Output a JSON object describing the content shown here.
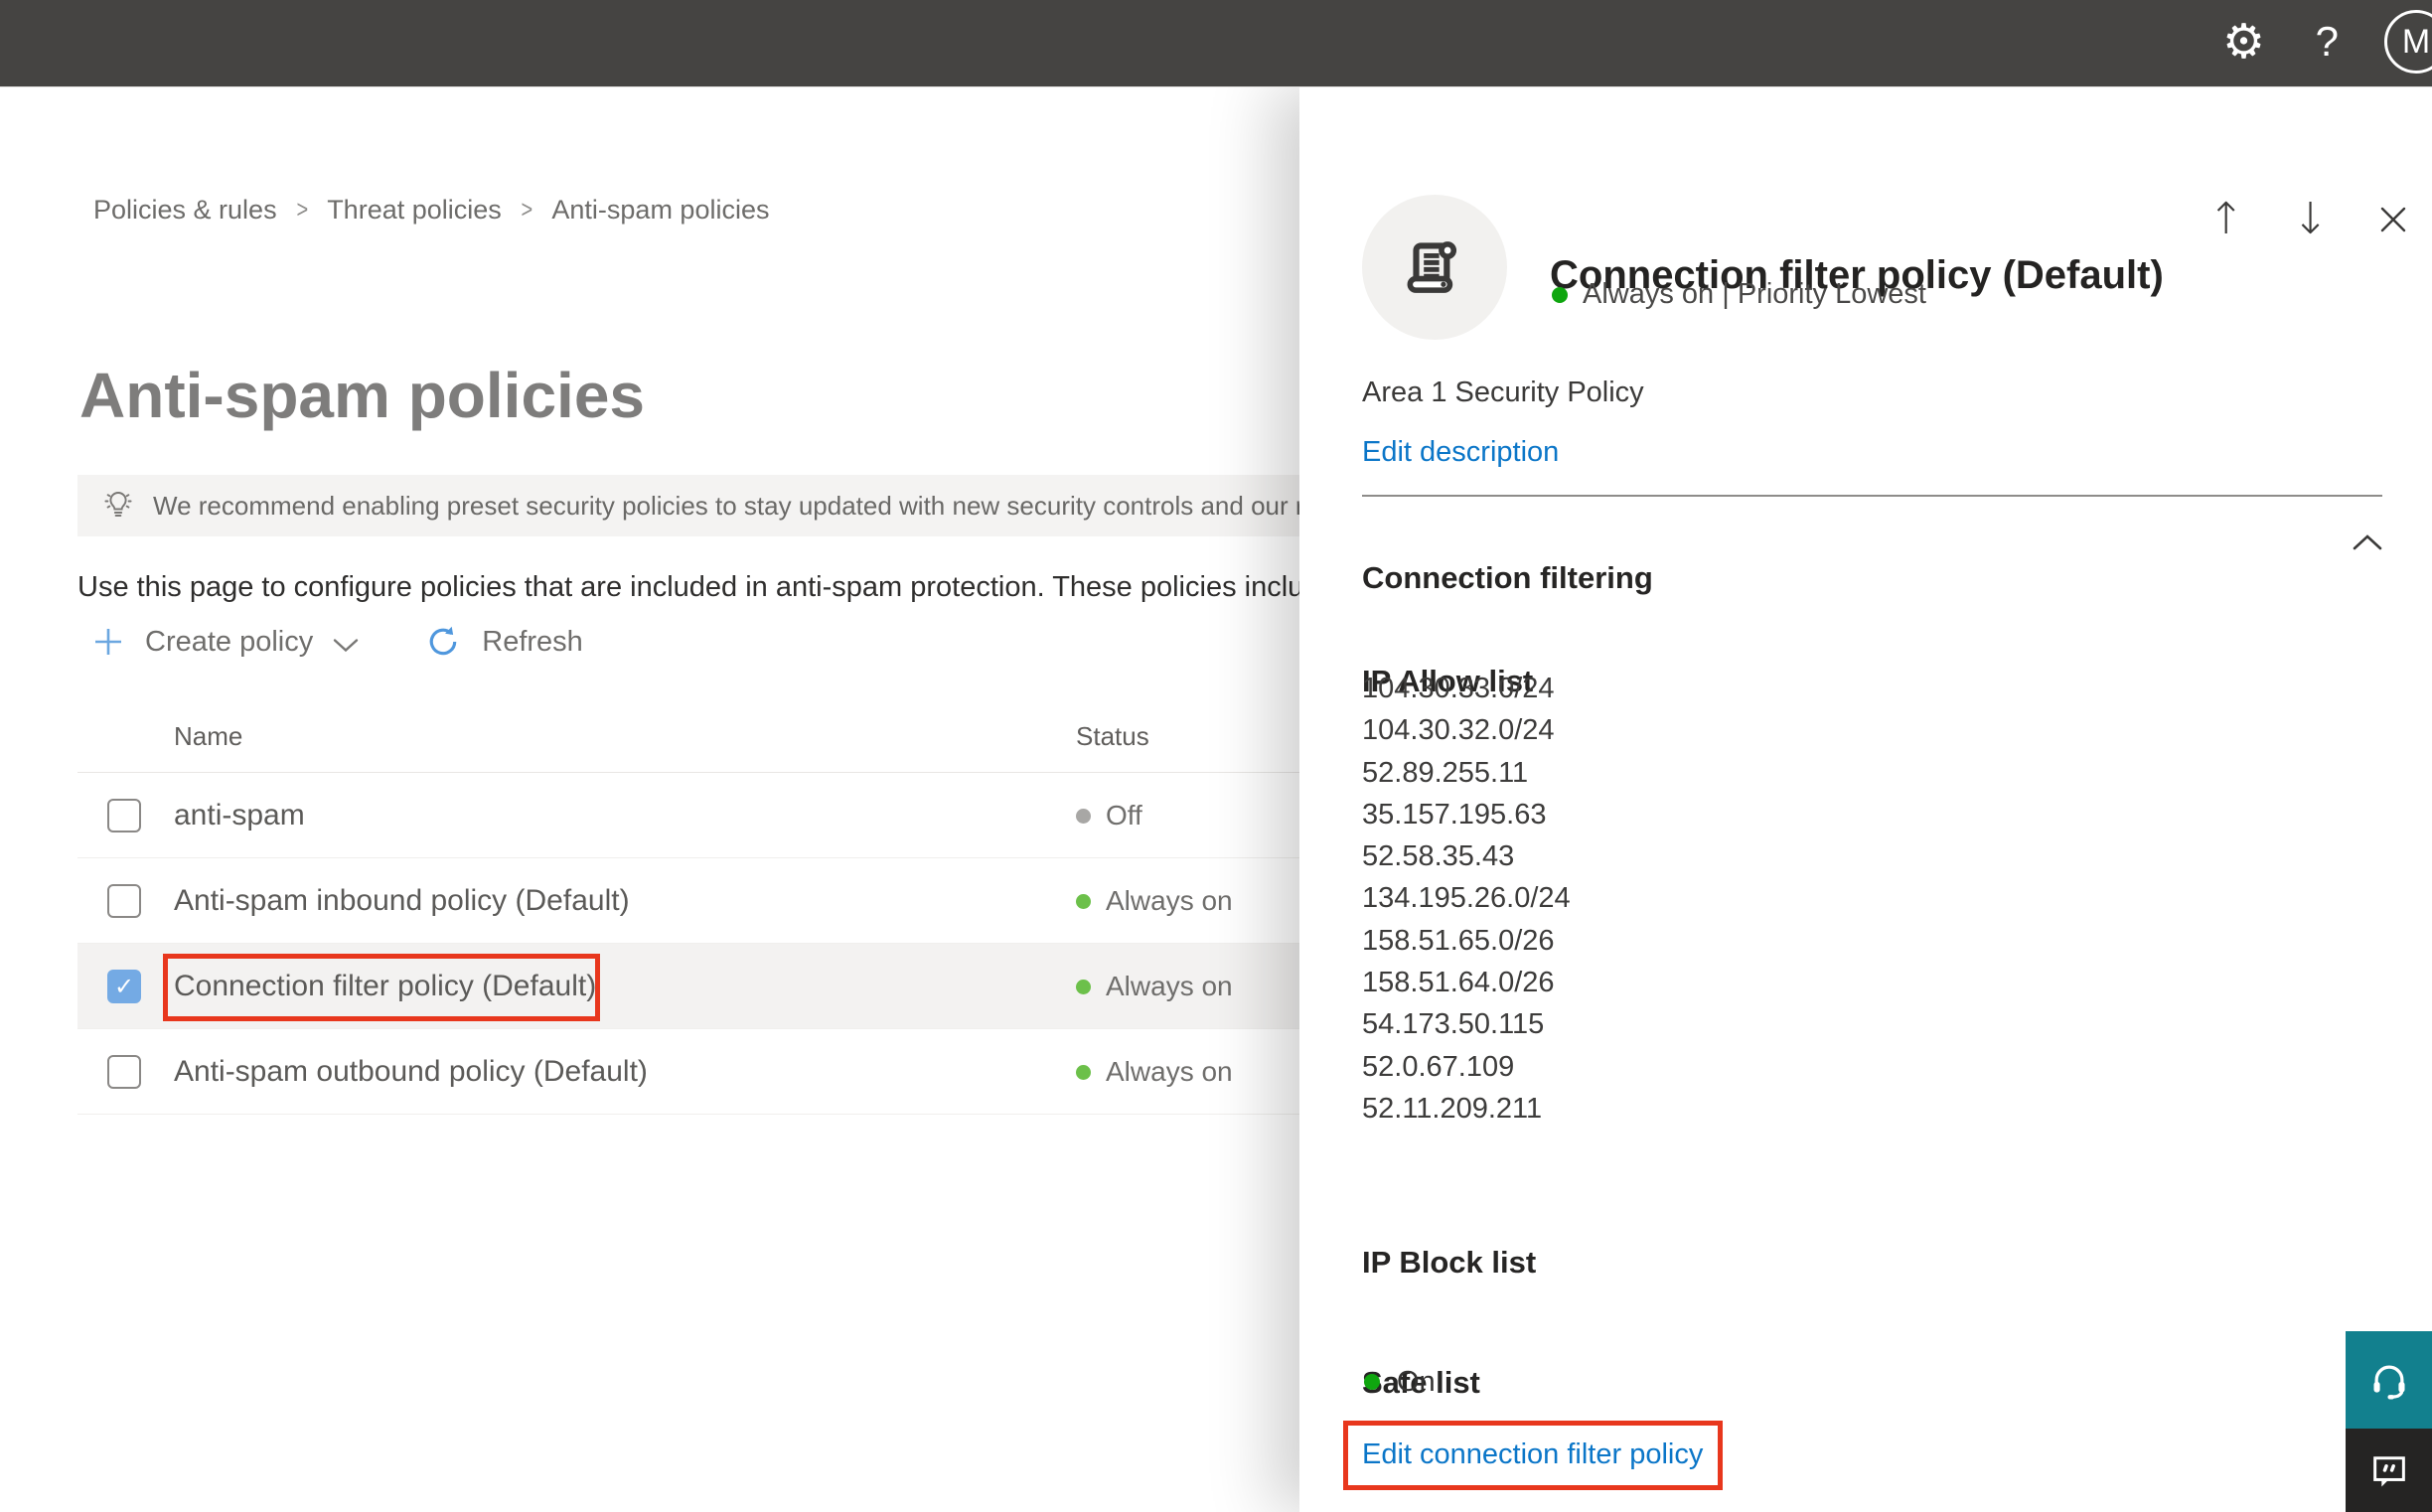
{
  "topbar": {
    "avatar_initial": "M"
  },
  "breadcrumb": {
    "items": [
      "Policies & rules",
      "Threat policies",
      "Anti-spam policies"
    ],
    "separator": ">"
  },
  "page": {
    "title": "Anti-spam policies",
    "banner_text": "We recommend enabling preset security policies to stay updated with new security controls and our recomme",
    "intro_text": "Use this page to configure policies that are included in anti-spam protection. These policies include"
  },
  "toolbar": {
    "create_policy_label": "Create policy",
    "refresh_label": "Refresh"
  },
  "table": {
    "columns": [
      "Name",
      "Status"
    ],
    "rows": [
      {
        "name": "anti-spam",
        "status": "Off",
        "status_color": "#a8a7a5",
        "checked": false,
        "selected": false,
        "annotated": false
      },
      {
        "name": "Anti-spam inbound policy (Default)",
        "status": "Always on",
        "status_color": "#6cc04a",
        "checked": false,
        "selected": false,
        "annotated": false
      },
      {
        "name": "Connection filter policy (Default)",
        "status": "Always on",
        "status_color": "#6cc04a",
        "checked": true,
        "selected": true,
        "annotated": true
      },
      {
        "name": "Anti-spam outbound policy (Default)",
        "status": "Always on",
        "status_color": "#6cc04a",
        "checked": false,
        "selected": false,
        "annotated": false
      }
    ]
  },
  "flyout": {
    "title": "Connection filter policy (Default)",
    "status_line": "Always on | Priority Lowest",
    "description": "Area 1 Security Policy",
    "edit_description_label": "Edit description",
    "section_title": "Connection filtering",
    "ip_allow_title": "IP Allow list",
    "ip_allow_items": [
      "104.30.33.0/24",
      "104.30.32.0/24",
      "52.89.255.11",
      "35.157.195.63",
      "52.58.35.43",
      "134.195.26.0/24",
      "158.51.65.0/26",
      "158.51.64.0/26",
      "54.173.50.115",
      "52.0.67.109",
      "52.11.209.211"
    ],
    "ip_block_title": "IP Block list",
    "safe_list_title": "Safe list",
    "safe_list_status": "On",
    "edit_link_label": "Edit connection filter policy"
  },
  "colors": {
    "topbar_bg": "#454442",
    "link_blue": "#0b76c8",
    "annotation_red": "#e8371d",
    "green_bright": "#0fa60f",
    "green_soft": "#6cc04a",
    "gray_dot": "#a8a7a5",
    "teal": "#12808e",
    "checkbox_blue": "#74aae4"
  }
}
